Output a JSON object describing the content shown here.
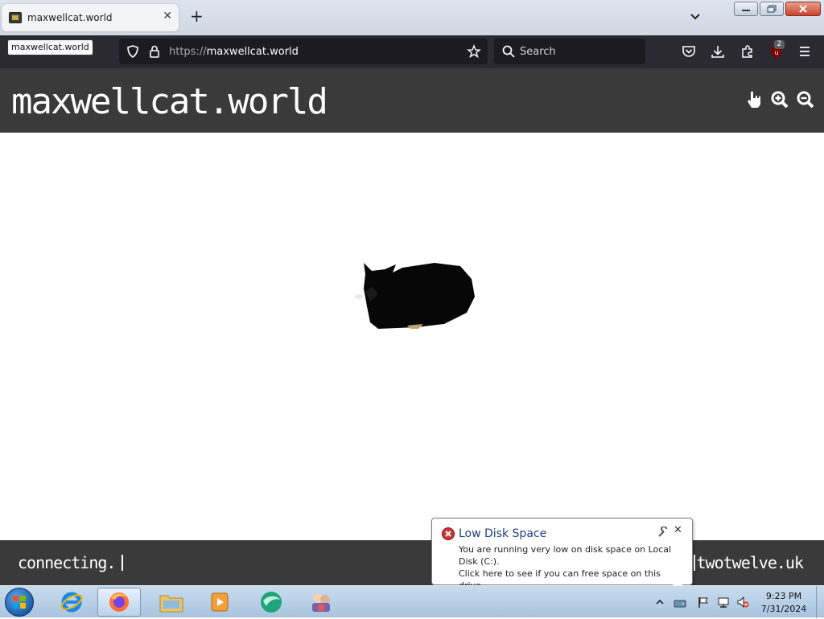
{
  "browser": {
    "tab_title": "maxwellcat.world",
    "tooltip": "maxwellcat.world",
    "url_scheme": "https://",
    "url_host": "maxwellcat.world",
    "search_placeholder": "Search",
    "extension_badge": "2"
  },
  "site": {
    "title": "maxwellcat.world",
    "status": "connecting.",
    "credit": "twotwelve.uk"
  },
  "notification": {
    "title": "Low Disk Space",
    "line1": "You are running very low on disk space on Local Disk (C:).",
    "line2": "Click here to see if you can free space on this drive."
  },
  "taskbar": {
    "time": "9:23 PM",
    "date": "7/31/2024"
  },
  "colors": {
    "site_bar": "#3a3a3a",
    "browser_dark": "#2b2a33",
    "taskbar": "#bcd3ea"
  }
}
